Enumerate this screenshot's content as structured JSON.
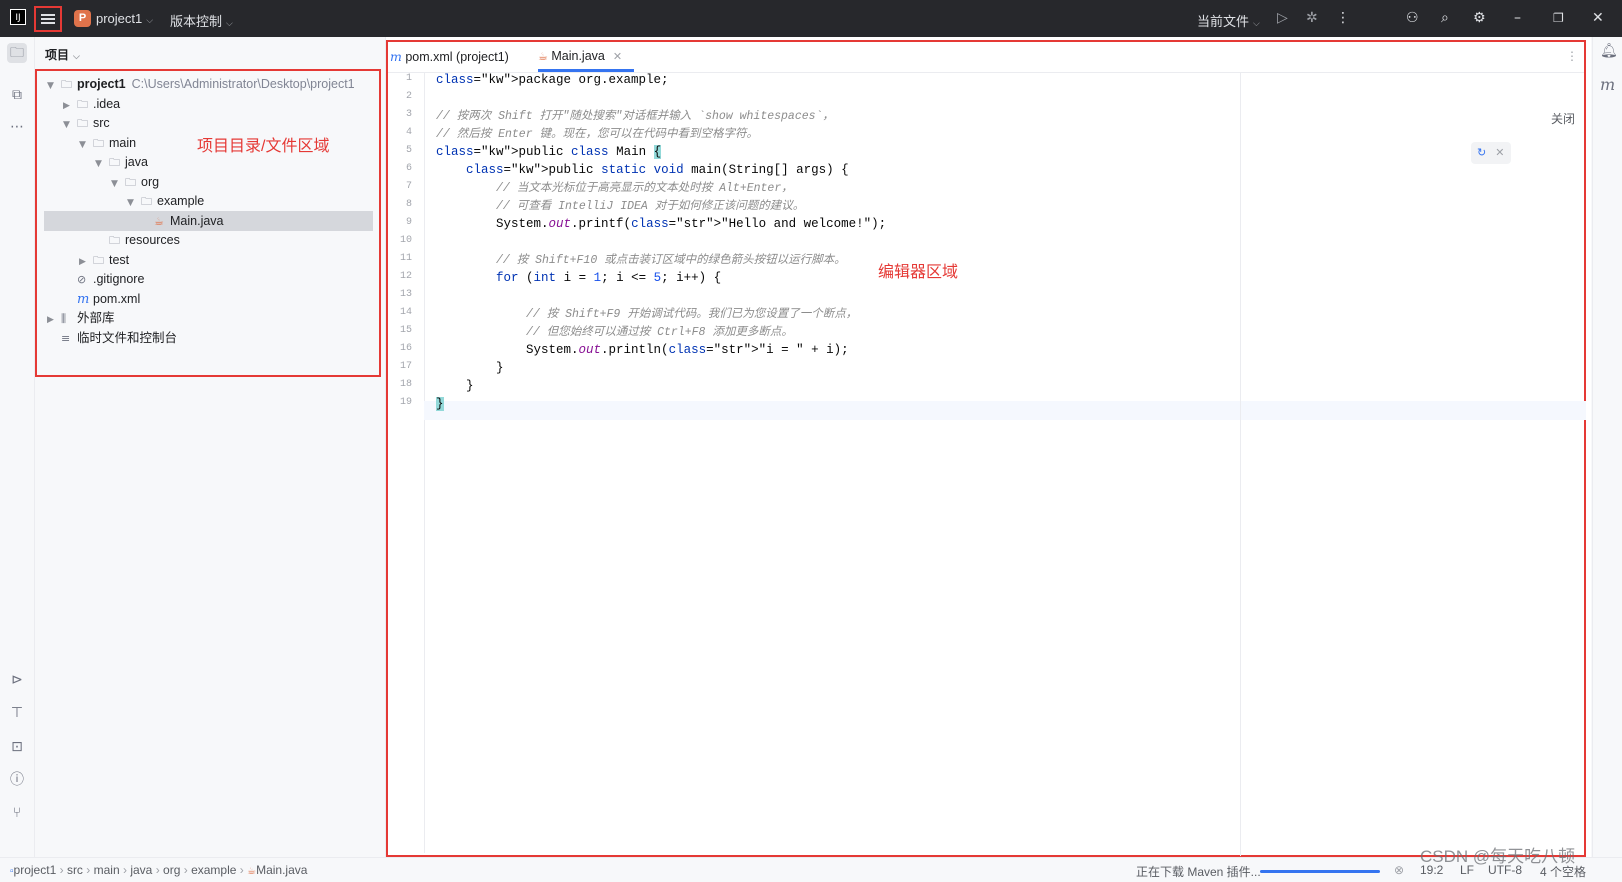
{
  "titlebar": {
    "logo": "IJ",
    "project_badge": "P",
    "project_name": "project1",
    "vcs_label": "版本控制",
    "current_file": "当前文件",
    "icons": [
      "hamburger-icon",
      "run-icon",
      "debug-icon",
      "more-icon",
      "add-user-icon",
      "search-icon",
      "settings-icon",
      "minimize-icon",
      "restore-icon",
      "close-icon"
    ]
  },
  "project_panel": {
    "header": "项目",
    "annotation": "项目目录/文件区域",
    "tree": [
      {
        "label": "project1",
        "path": "C:\\Users\\Administrator\\Desktop\\project1",
        "icon": "module-folder-icon",
        "expanded": true
      },
      {
        "label": ".idea",
        "icon": "folder-icon",
        "expanded": false
      },
      {
        "label": "src",
        "icon": "folder-icon",
        "expanded": true
      },
      {
        "label": "main",
        "icon": "folder-icon",
        "expanded": true
      },
      {
        "label": "java",
        "icon": "folder-icon",
        "expanded": true
      },
      {
        "label": "org",
        "icon": "folder-icon",
        "expanded": true
      },
      {
        "label": "example",
        "icon": "folder-icon",
        "expanded": true
      },
      {
        "label": "Main.java",
        "icon": "java-file-icon",
        "selected": true
      },
      {
        "label": "resources",
        "icon": "folder-icon"
      },
      {
        "label": "test",
        "icon": "folder-icon",
        "expanded": false
      },
      {
        "label": ".gitignore",
        "icon": "gitignore-icon"
      },
      {
        "label": "pom.xml",
        "icon": "maven-icon"
      },
      {
        "label": "外部库",
        "icon": "library-icon",
        "expanded": false
      },
      {
        "label": "临时文件和控制台",
        "icon": "scratch-icon"
      }
    ]
  },
  "editor": {
    "tabs": [
      {
        "label": "pom.xml (project1)",
        "icon": "maven-icon",
        "active": false
      },
      {
        "label": "Main.java",
        "icon": "java-file-icon",
        "active": true
      }
    ],
    "close_hint": "关闭",
    "annotation": "编辑器区域",
    "lines": [
      "package org.example;",
      "",
      "// 按两次 Shift 打开\"随处搜索\"对话框并输入 `show whitespaces`，",
      "// 然后按 Enter 键。现在，您可以在代码中看到空格字符。",
      "public class Main {",
      "    public static void main(String[] args) {",
      "        // 当文本光标位于高亮显示的文本处时按 Alt+Enter，",
      "        // 可查看 IntelliJ IDEA 对于如何修正该问题的建议。",
      "        System.out.printf(\"Hello and welcome!\");",
      "",
      "        // 按 Shift+F10 或点击装订区域中的绿色箭头按钮以运行脚本。",
      "        for (int i = 1; i <= 5; i++) {",
      "",
      "            // 按 Shift+F9 开始调试代码。我们已为您设置了一个断点，",
      "            // 但您始终可以通过按 Ctrl+F8 添加更多断点。",
      "            System.out.println(\"i = \" + i);",
      "        }",
      "    }",
      "}"
    ],
    "line_numbers": [
      "1",
      "2",
      "3",
      "4",
      "5",
      "6",
      "7",
      "8",
      "9",
      "10",
      "11",
      "12",
      "13",
      "14",
      "15",
      "16",
      "17",
      "18",
      "19"
    ]
  },
  "statusbar": {
    "breadcrumbs": [
      "project1",
      "src",
      "main",
      "java",
      "org",
      "example",
      "Main.java"
    ],
    "task": "正在下载 Maven 插件...",
    "caret": "19:2",
    "line_sep": "LF",
    "encoding": "UTF-8",
    "indent": "4 个空格"
  },
  "watermark": "CSDN @每天吃八顿"
}
